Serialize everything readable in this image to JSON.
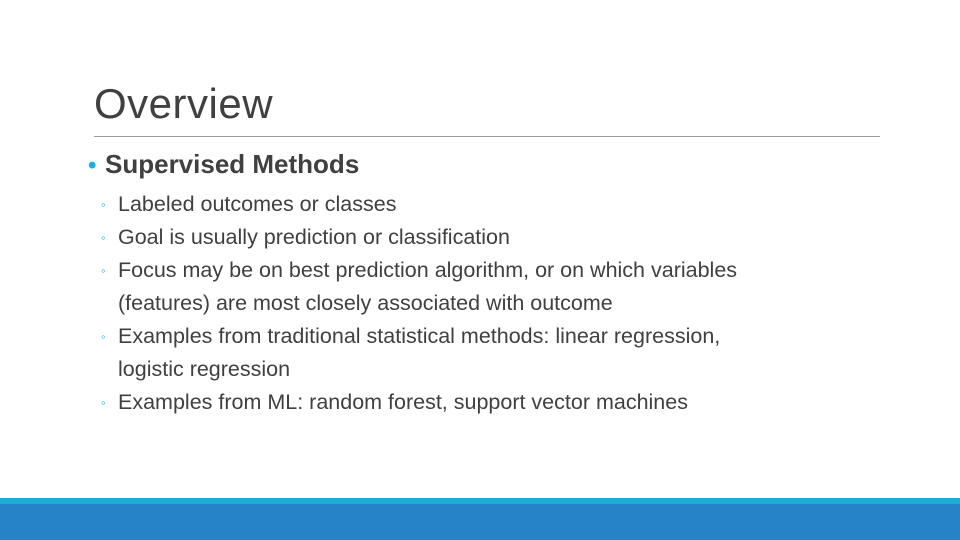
{
  "slide": {
    "title": "Overview",
    "section": {
      "bullet": "•",
      "heading": "Supervised Methods",
      "sub_bullet": "◦",
      "items": [
        {
          "lines": [
            "Labeled outcomes or classes"
          ]
        },
        {
          "lines": [
            "Goal is usually prediction or classification"
          ]
        },
        {
          "lines": [
            "Focus may be on best prediction algorithm, or on which variables",
            "(features) are most closely associated with outcome"
          ]
        },
        {
          "lines": [
            "Examples from traditional statistical methods: linear regression,",
            "logistic regression"
          ]
        },
        {
          "lines": [
            "Examples from ML: random forest, support vector machines"
          ]
        }
      ]
    },
    "colors": {
      "accent": "#1CADE4",
      "band_light": "#1FA9DE",
      "band_dark": "#2683C6",
      "text": "#404040"
    }
  }
}
